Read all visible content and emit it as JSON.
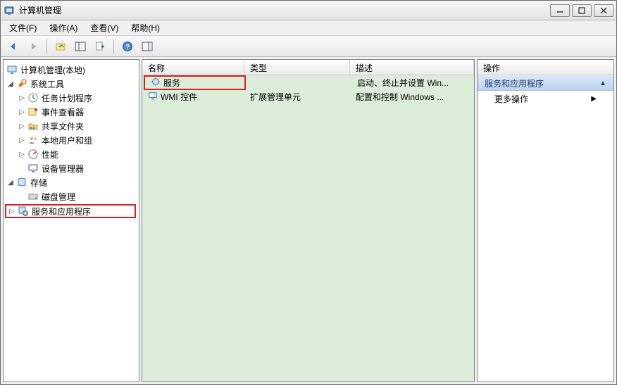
{
  "window": {
    "title": "计算机管理"
  },
  "menu": {
    "file": "文件(F)",
    "action": "操作(A)",
    "view": "查看(V)",
    "help": "帮助(H)"
  },
  "tree": {
    "root": "计算机管理(本地)",
    "system_tools": "系统工具",
    "task_scheduler": "任务计划程序",
    "event_viewer": "事件查看器",
    "shared_folders": "共享文件夹",
    "local_users": "本地用户和组",
    "performance": "性能",
    "device_manager": "设备管理器",
    "storage": "存储",
    "disk_management": "磁盘管理",
    "services_apps": "服务和应用程序"
  },
  "list": {
    "headers": {
      "name": "名称",
      "type": "类型",
      "desc": "描述"
    },
    "rows": [
      {
        "name": "服务",
        "type": "",
        "desc": "启动、终止并设置 Win..."
      },
      {
        "name": "WMI 控件",
        "type": "扩展管理单元",
        "desc": "配置和控制 Windows ..."
      }
    ]
  },
  "actions": {
    "header": "操作",
    "group": "服务和应用程序",
    "more": "更多操作"
  }
}
